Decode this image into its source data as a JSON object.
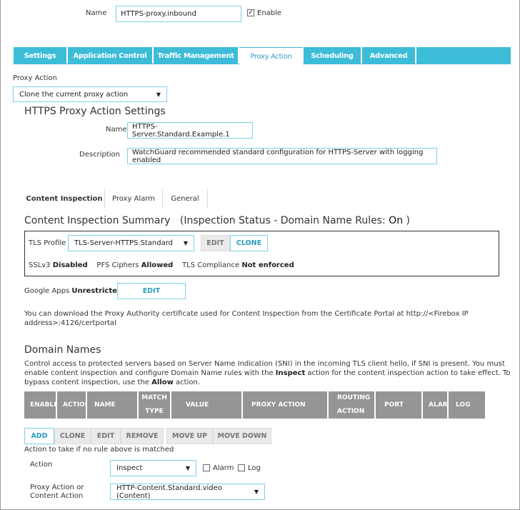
{
  "header": {
    "name_label": "Name",
    "name_value": "HTTPS-proxy.inbound",
    "enable_label": "Enable",
    "enable_checked": true
  },
  "tabs": [
    {
      "label": "Settings"
    },
    {
      "label": "Application Control"
    },
    {
      "label": "Traffic Management"
    },
    {
      "label": "Proxy Action",
      "active": true
    },
    {
      "label": "Scheduling"
    },
    {
      "label": "Advanced"
    }
  ],
  "proxy_action": {
    "label": "Proxy Action",
    "selected": "Clone the current proxy action"
  },
  "settings": {
    "title": "HTTPS Proxy Action Settings",
    "name_label": "Name",
    "name_value": "HTTPS-Server.Standard.Example.1",
    "description_label": "Description",
    "description_value": "WatchGuard recommended standard configuration for HTTPS-Server with logging enabled"
  },
  "subtabs": [
    {
      "label": "Content Inspection",
      "active": true
    },
    {
      "label": "Proxy Alarm"
    },
    {
      "label": "General"
    }
  ],
  "summary": {
    "title": "Content Inspection Summary",
    "status_prefix": "(Inspection Status  -  Domain Name Rules:",
    "status_value": "On",
    "status_suffix": ")"
  },
  "tls": {
    "label": "TLS Profile",
    "selected": "TLS-Server-HTTPS.Standard",
    "edit": "EDIT",
    "clone": "CLONE",
    "sslv3_label": "SSLv3",
    "sslv3_value": "Disabled",
    "pfs_label": "PFS Ciphers",
    "pfs_value": "Allowed",
    "compliance_label": "TLS Compliance",
    "compliance_value": "Not enforced"
  },
  "google": {
    "label": "Google Apps",
    "value": "Unrestricted",
    "edit": "EDIT"
  },
  "download_note": "You can download the Proxy Authority certificate used for Content Inspection from the Certificate Portal at http://<Firebox IP address>:4126/certportal",
  "domain": {
    "title": "Domain Names",
    "desc1": "Control access to protected servers based on Server Name Indication (SNI) in the incoming TLS client hello, if SNI is present. You must enable content inspection and configure Domain Name rules with the ",
    "desc_inspect": "Inspect",
    "desc2": " action for the content inspection action to take effect. To bypass content inspection, use the ",
    "desc_allow": "Allow",
    "desc3": " action.",
    "columns": [
      "ENABLE",
      "ACTION",
      "NAME",
      "MATCH TYPE",
      "VALUE",
      "PROXY ACTION",
      "ROUTING ACTION",
      "PORT",
      "ALARM",
      "LOG"
    ],
    "buttons": {
      "add": "ADD",
      "clone": "CLONE",
      "edit": "EDIT",
      "remove": "REMOVE",
      "move_up": "MOVE UP",
      "move_down": "MOVE DOWN"
    },
    "no_match_label": "Action to take if no rule above is matched",
    "action_label": "Action",
    "action_value": "Inspect",
    "alarm_label": "Alarm",
    "log_label": "Log",
    "proxy_action_label": "Proxy Action or Content Action",
    "proxy_action_value": "HTTP-Content.Standard.video (Content)"
  }
}
